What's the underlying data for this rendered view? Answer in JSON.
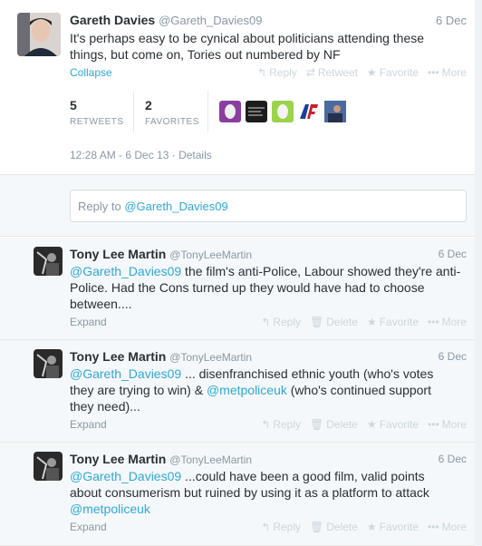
{
  "main_tweet": {
    "name": "Gareth Davies",
    "handle": "@Gareth_Davies09",
    "date": "6 Dec",
    "text": "It's perhaps easy to be cynical about politicians attending these things, but come on, Tories out numbered by NF",
    "collapse": "Collapse",
    "actions": {
      "reply": "Reply",
      "retweet": "Retweet",
      "favorite": "Favorite",
      "more": "More"
    },
    "retweets_count": "5",
    "retweets_label": "RETWEETS",
    "favorites_count": "2",
    "favorites_label": "FAVORITES",
    "favoriter_avatars": [
      "purple-egg-avatar",
      "dark-text-avatar",
      "green-egg-avatar",
      "nf-logo-avatar",
      "photo-avatar"
    ],
    "timestamp": "12:28 AM - 6 Dec 13",
    "details_separator": " · ",
    "details": "Details"
  },
  "reply_box": {
    "prefix": "Reply to ",
    "mention": "@Gareth_Davies09"
  },
  "replies": [
    {
      "name": "Tony Lee Martin",
      "handle": "@TonyLeeMartin",
      "date": "6 Dec",
      "mention": "@Gareth_Davies09",
      "text_after_mention": " the film's anti-Police, Labour showed they're anti-Police. Had the Cons turned up they would have had to choose between....",
      "expand": "Expand",
      "actions": {
        "reply": "Reply",
        "delete": "Delete",
        "favorite": "Favorite",
        "more": "More"
      }
    },
    {
      "name": "Tony Lee Martin",
      "handle": "@TonyLeeMartin",
      "date": "6 Dec",
      "mention": "@Gareth_Davies09",
      "text_mid": " ... disenfranchised ethnic youth (who's votes they are trying to win) & ",
      "mention2": "@metpoliceuk",
      "text_after": " (who's continued support they need)...",
      "expand": "Expand",
      "actions": {
        "reply": "Reply",
        "delete": "Delete",
        "favorite": "Favorite",
        "more": "More"
      }
    },
    {
      "name": "Tony Lee Martin",
      "handle": "@TonyLeeMartin",
      "date": "6 Dec",
      "mention": "@Gareth_Davies09",
      "text_mid": " ...could have been a good film, valid points about consumerism but ruined by using it as a platform to attack ",
      "mention2": "@metpoliceuk",
      "expand": "Expand",
      "actions": {
        "reply": "Reply",
        "delete": "Delete",
        "favorite": "Favorite",
        "more": "More"
      }
    }
  ],
  "colors": {
    "link": "#2fa8d8",
    "muted": "#8899a6",
    "reply_bg": "#f5f8fa"
  }
}
